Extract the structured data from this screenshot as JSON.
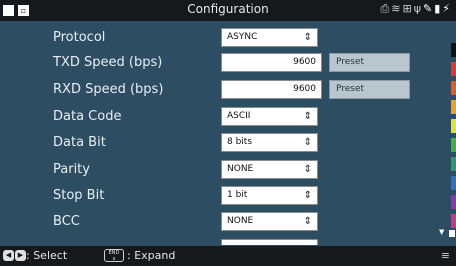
{
  "window": {
    "title": "Configuration"
  },
  "status_icons": [
    "printer-icon",
    "wifi-icon",
    "network-icon",
    "usb-icon",
    "tool-icon",
    "sd-card-icon",
    "battery-icon"
  ],
  "fields": [
    {
      "label": "Protocol",
      "value": "ASYNC",
      "kind": "select"
    },
    {
      "label": "TXD Speed (bps)",
      "value": "9600",
      "kind": "number",
      "button": "Preset"
    },
    {
      "label": "RXD Speed (bps)",
      "value": "9600",
      "kind": "number",
      "button": "Preset"
    },
    {
      "label": "Data Code",
      "value": "ASCII",
      "kind": "select"
    },
    {
      "label": "Data Bit",
      "value": "8 bits",
      "kind": "select"
    },
    {
      "label": "Parity",
      "value": "NONE",
      "kind": "select"
    },
    {
      "label": "Stop Bit",
      "value": "1 bit",
      "kind": "select"
    },
    {
      "label": "BCC",
      "value": "NONE",
      "kind": "select"
    }
  ],
  "sidebar_colors": [
    "#111111",
    "#d93a3a",
    "#e05a2a",
    "#f0a020",
    "#e8e030",
    "#40b040",
    "#2a9a6a",
    "#3070c0",
    "#8a3ab0",
    "#c03a90"
  ],
  "footer": {
    "select_hint": ": Select",
    "end_key": "END",
    "end_key_sub": "x",
    "expand_hint": ": Expand"
  }
}
